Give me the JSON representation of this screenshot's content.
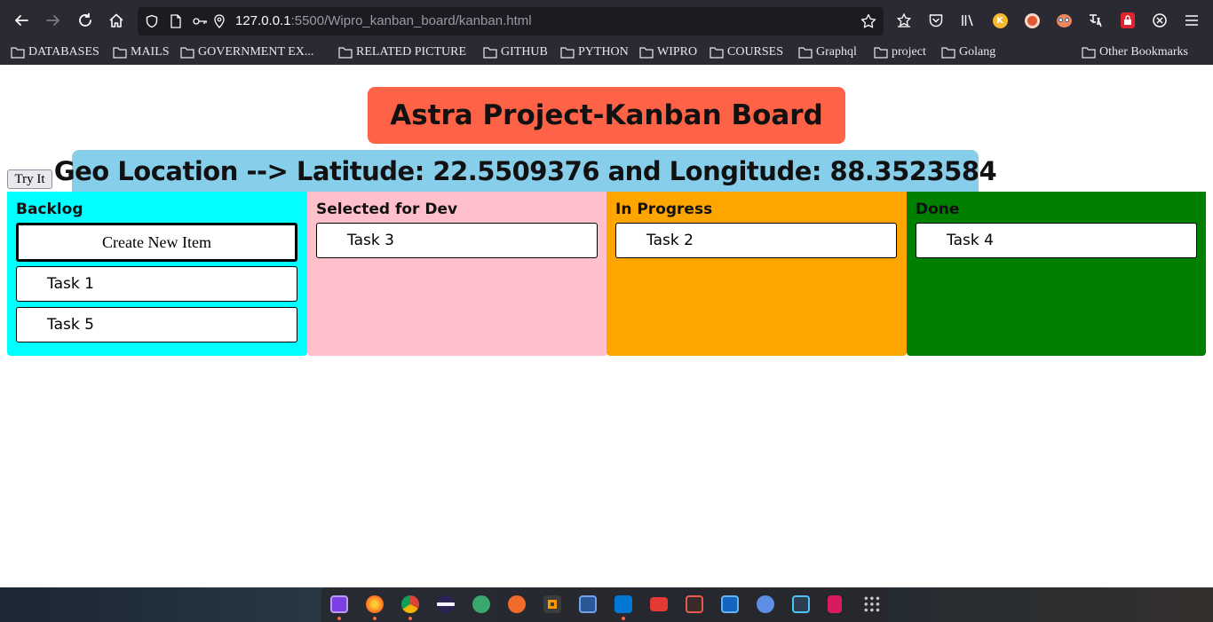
{
  "browser": {
    "url_host": "127.0.0.1",
    "url_path": ":5500/Wipro_kanban_board/kanban.html",
    "bookmarks": [
      "DATABASES",
      "MAILS",
      "GOVERNMENT EX...",
      "RELATED PICTURE",
      "GITHUB",
      "PYTHON",
      "WIPRO",
      "COURSES",
      "Graphql",
      "project",
      "Golang"
    ],
    "other_bookmarks": "Other Bookmarks",
    "extension_k": "K"
  },
  "page": {
    "title": "Astra Project-Kanban Board",
    "try_button": "Try It",
    "geo_text": "Geo Location --> Latitude: 22.5509376 and Longitude: 88.3523584"
  },
  "columns": [
    {
      "title": "Backlog",
      "color": "#00ffff",
      "create_label": "Create New Item",
      "cards": [
        "Task 1",
        "Task 5"
      ]
    },
    {
      "title": "Selected for Dev",
      "color": "#ffc0cb",
      "cards": [
        "Task 3"
      ]
    },
    {
      "title": "In Progress",
      "color": "#ffa500",
      "cards": [
        "Task 2"
      ]
    },
    {
      "title": "Done",
      "color": "#008000",
      "cards": [
        "Task 4"
      ]
    }
  ],
  "colors": {
    "title_bg": "#ff6347",
    "geo_bg": "#87ceeb",
    "chrome_bg": "#2b2a33"
  },
  "taskbar": {
    "apps": [
      "tasks-icon",
      "firefox-icon",
      "chrome-icon",
      "eclipse-icon",
      "globe-icon",
      "safari-icon",
      "sublime-icon",
      "editor-icon",
      "vscode-icon",
      "files-icon",
      "monitor-icon",
      "screenshot-icon",
      "settings-icon",
      "terminal-icon",
      "trash-icon",
      "app-grid-icon"
    ]
  }
}
